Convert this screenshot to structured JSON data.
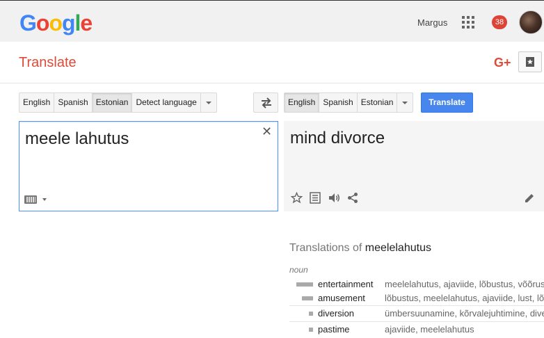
{
  "header": {
    "logo_letters": [
      "G",
      "o",
      "o",
      "g",
      "l",
      "e"
    ],
    "logo_colors": [
      "#4285f4",
      "#ea4335",
      "#fbbc05",
      "#4285f4",
      "#34a853",
      "#ea4335"
    ],
    "user_name": "Margus",
    "notification_count": "38"
  },
  "subheader": {
    "app_title": "Translate",
    "gplus_label": "G+"
  },
  "source_langs": {
    "items": [
      "English",
      "Spanish",
      "Estonian",
      "Detect language"
    ],
    "selected": "Estonian"
  },
  "target_langs": {
    "items": [
      "English",
      "Spanish",
      "Estonian"
    ],
    "selected": "English"
  },
  "translate_button": "Translate",
  "source": {
    "text": "meele lahutus",
    "clear_symbol": "✕"
  },
  "result": {
    "text": "mind divorce"
  },
  "dictionary": {
    "title_prefix": "Translations of ",
    "title_word": "meelelahutus",
    "part_of_speech": "noun",
    "rows": [
      {
        "word": "entertainment",
        "frequency": 3,
        "synonyms": "meelelahutus, ajaviide, lõbustus, võõrustamine"
      },
      {
        "word": "amusement",
        "frequency": 2,
        "synonyms": "lõbustus, meelelahutus, ajaviide, lust, lõbu"
      },
      {
        "word": "diversion",
        "frequency": 1,
        "synonyms": "ümbersuunamine, kõrvalejuhtimine, diversioon"
      },
      {
        "word": "pastime",
        "frequency": 1,
        "synonyms": "ajaviide, meelelahutus"
      }
    ]
  },
  "icons": {
    "apps": "apps-grid-icon",
    "book": "phrasebook-icon",
    "swap": "swap-icon",
    "keyboard": "keyboard-icon",
    "star": "star-icon",
    "list": "list-icon",
    "speaker": "speaker-icon",
    "share": "share-icon",
    "edit": "pencil-icon"
  }
}
